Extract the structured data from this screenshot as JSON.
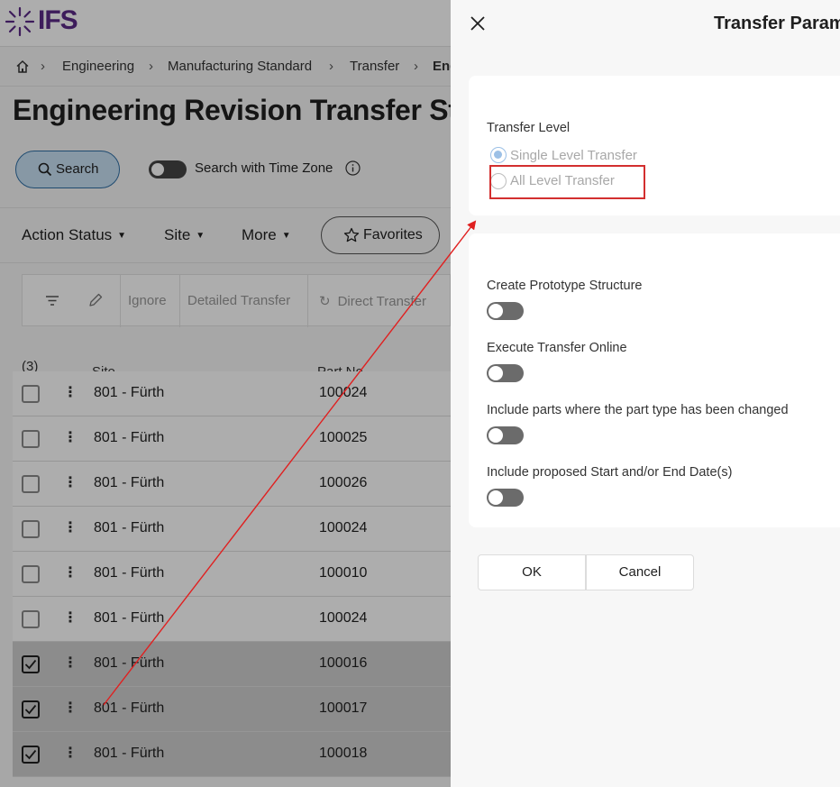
{
  "app": {
    "logo_text": "IFS"
  },
  "breadcrumb": [
    "Engineering",
    "Manufacturing Standard",
    "Transfer",
    "Eng"
  ],
  "page_title": "Engineering Revision Transfer St",
  "search": {
    "label": "Search",
    "timezone_label": "Search with Time Zone"
  },
  "filters": {
    "action_status": "Action Status",
    "site": "Site",
    "more": "More",
    "favorites": "Favorites"
  },
  "grid_toolbar": {
    "ignore": "Ignore",
    "detailed_transfer": "Detailed Transfer",
    "direct_transfer": "Direct Transfer"
  },
  "grid": {
    "selected_count": "(3)",
    "columns": {
      "site": "Site",
      "part_no": "Part No"
    },
    "rows": [
      {
        "site": "801 - Fürth",
        "part": "100024",
        "selected": false
      },
      {
        "site": "801 - Fürth",
        "part": "100025",
        "selected": false
      },
      {
        "site": "801 - Fürth",
        "part": "100026",
        "selected": false
      },
      {
        "site": "801 - Fürth",
        "part": "100024",
        "selected": false
      },
      {
        "site": "801 - Fürth",
        "part": "100010",
        "selected": false
      },
      {
        "site": "801 - Fürth",
        "part": "100024",
        "selected": false
      },
      {
        "site": "801 - Fürth",
        "part": "100016",
        "selected": true
      },
      {
        "site": "801 - Fürth",
        "part": "100017",
        "selected": true
      },
      {
        "site": "801 - Fürth",
        "part": "100018",
        "selected": true
      }
    ]
  },
  "dialog": {
    "title": "Transfer Param",
    "transfer_level_label": "Transfer Level",
    "single_level": "Single Level Transfer",
    "all_level": "All Level Transfer",
    "create_prototype": "Create Prototype Structure",
    "execute_online": "Execute Transfer Online",
    "include_part_type_changed": "Include parts where the part type has been changed",
    "include_proposed_dates": "Include proposed Start and/or End Date(s)",
    "ok": "OK",
    "cancel": "Cancel"
  },
  "colors": {
    "brand": "#5b2a86",
    "annotation": "#d32f2f",
    "search_bg": "#c7e0f4"
  }
}
